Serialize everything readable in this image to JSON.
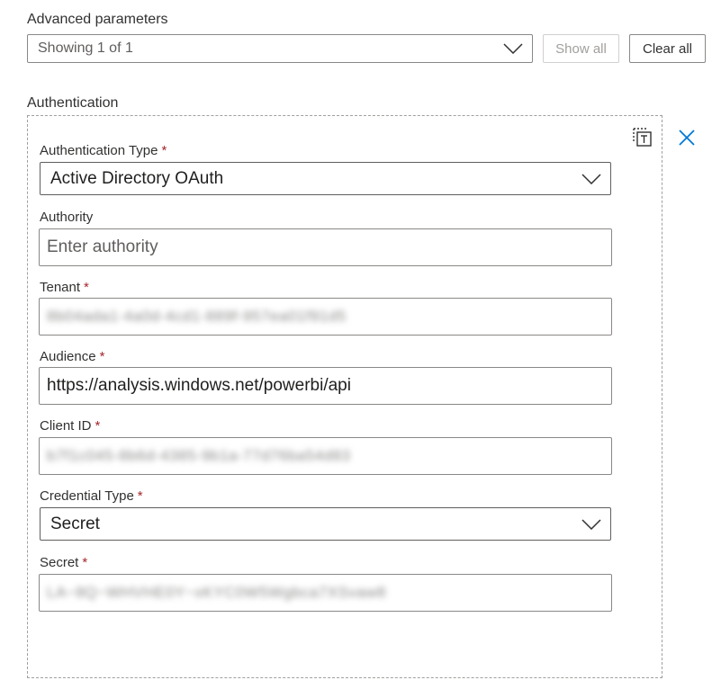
{
  "advanced": {
    "title": "Advanced parameters",
    "selector_value": "Showing 1 of 1",
    "show_all_label": "Show all",
    "clear_all_label": "Clear all"
  },
  "auth": {
    "section_title": "Authentication",
    "auth_type": {
      "label": "Authentication Type",
      "required_mark": "*",
      "value": "Active Directory OAuth"
    },
    "authority": {
      "label": "Authority",
      "placeholder": "Enter authority"
    },
    "tenant": {
      "label": "Tenant",
      "required_mark": "*",
      "value": "8b04ada1-4a0d-4cd1-889f-957ea01f91d5"
    },
    "audience": {
      "label": "Audience",
      "required_mark": "*",
      "value": "https://analysis.windows.net/powerbi/api"
    },
    "client_id": {
      "label": "Client ID",
      "required_mark": "*",
      "value": "b7f1c045-8b6d-4385-9b1a-77d76ba54d83"
    },
    "credential_type": {
      "label": "Credential Type",
      "required_mark": "*",
      "value": "Secret"
    },
    "secret": {
      "label": "Secret",
      "required_mark": "*",
      "value": "LA~8Q~WHVHE0Y~xKYC0W5Wgbca7XSvaw8"
    }
  },
  "icons": {
    "chevron": "chevron-down-icon",
    "delete": "delete-parameter-icon",
    "close": "close-icon"
  },
  "colors": {
    "accent": "#0078d4",
    "required": "#a4262c",
    "border": "#8a8886"
  }
}
